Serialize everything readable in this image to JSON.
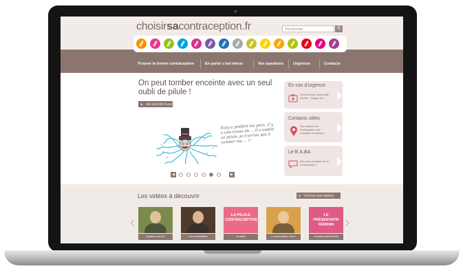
{
  "site": {
    "logo_prefix": "choisir",
    "logo_bold": "sa",
    "logo_suffix": "contraception.fr",
    "search_placeholder": "Rechercher",
    "search_icon": "magnifier-icon"
  },
  "pill_colors": [
    "#f29400",
    "#e8388a",
    "#95c11f",
    "#009fe3",
    "#d62f8a",
    "#7b5aa6",
    "#1d71b8",
    "#a9a9a9",
    "#c8c32a",
    "#ffd100",
    "#f7a600",
    "#b1c200",
    "#e30613",
    "#e4007d",
    "#9e3f8f"
  ],
  "nav": {
    "items": [
      {
        "label": "Trouver la bonne contraception"
      },
      {
        "label": "En parler c'est mieux"
      },
      {
        "label": "Vos questions"
      },
      {
        "label": "Urgences"
      },
      {
        "label": "Contacts"
      }
    ]
  },
  "hero": {
    "headline": "On peut tomber enceinte avec un seul oubli de pilule !",
    "read_more": "EN SAVOIR PLUS",
    "handwriting": "Suzy a préféré les yeux, il y a une tonne de ... il a oublié sa pilule, je n'arrive pas à tomber ma ... !!",
    "carousel_dots": 6,
    "active_dot": 5
  },
  "cards": [
    {
      "title": "En cas d'urgence",
      "text": "Oubli de pilule, préservatif déchiré... Réagir vite !",
      "icon": "first-aid-kit-icon"
    },
    {
      "title": "Contacts utiles",
      "text": "Pour obtenir une contraception, être conseillée et informée.",
      "icon": "map-pin-icon"
    },
    {
      "title": "Le B.A.BA",
      "text": "Êtes-vous incollable sur la contraception ?",
      "icon": "speech-bubble-icon"
    }
  ],
  "videos": {
    "heading": "Les vidéos à découvrir",
    "all_button": "TOUTES LES VIDÉOS",
    "items": [
      {
        "caption": "Quelles sont les",
        "label": "",
        "bg": "#7d8a4d"
      },
      {
        "caption": "Une consultation",
        "label": "",
        "bg": "#4f3b2c"
      },
      {
        "caption": "La pilule",
        "label": "LA PILULE CONTRACEPTIVE",
        "bg": "#e96b85"
      },
      {
        "caption": "La prescription d'une",
        "label": "",
        "bg": "#d7a24a"
      },
      {
        "caption": "Le préservatif féminin",
        "label": "LE PRÉSERVATIF FÉMININ",
        "bg": "#e15a86"
      }
    ]
  },
  "colors": {
    "brand_taupe": "#8b766f",
    "accent_pink": "#e15a86"
  }
}
